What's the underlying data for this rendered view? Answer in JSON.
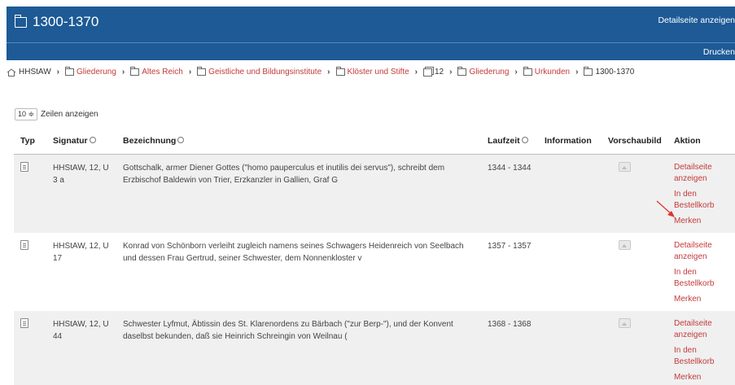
{
  "header": {
    "title": "1300-1370",
    "detail_link": "Detailseite anzeigen",
    "print_link": "Drucken"
  },
  "breadcrumb": [
    {
      "label": "HHStAW",
      "icon": "home-icon",
      "link": false
    },
    {
      "label": "Gliederung",
      "icon": "folder-icon",
      "link": true
    },
    {
      "label": "Altes Reich",
      "icon": "folder-icon",
      "link": true
    },
    {
      "label": "Geistliche und Bildungsinstitute",
      "icon": "folder-icon",
      "link": true
    },
    {
      "label": "Klöster und Stifte",
      "icon": "folder-icon",
      "link": true
    },
    {
      "label": "12",
      "icon": "stack-icon",
      "link": false
    },
    {
      "label": "Gliederung",
      "icon": "folder-icon",
      "link": true
    },
    {
      "label": "Urkunden",
      "icon": "folder-icon",
      "link": true
    },
    {
      "label": "1300-1370",
      "icon": "folder-icon",
      "link": false
    }
  ],
  "length": {
    "value": "10 ≑",
    "label": "Zeilen anzeigen"
  },
  "table": {
    "columns": {
      "typ": "Typ",
      "signatur": "Signatur",
      "bezeichnung": "Bezeichnung",
      "laufzeit": "Laufzeit",
      "information": "Information",
      "vorschaubild": "Vorschaubild",
      "aktion": "Aktion"
    },
    "actions": {
      "detail": "Detailseite anzeigen",
      "basket": "In den Bestellkorb",
      "remember": "Merken"
    },
    "rows": [
      {
        "signatur": "HHStAW, 12, U 3 a",
        "bezeichnung": "Gottschalk, armer Diener Gottes (\"homo pauperculus et inutilis dei servus\"), schreibt dem Erzbischof Baldewin von Trier, Erzkanzler in Gallien, Graf G",
        "laufzeit": "1344 - 1344",
        "information": ""
      },
      {
        "signatur": "HHStAW, 12, U 17",
        "bezeichnung": "Konrad von Schönborn verleiht zugleich namens seines Schwagers Heidenreich von Seelbach und dessen Frau Gertrud, seiner Schwester, dem Nonnenkloster v",
        "laufzeit": "1357 - 1357",
        "information": ""
      },
      {
        "signatur": "HHStAW, 12, U 44",
        "bezeichnung": "Schwester Lyfmut, Äbtissin des St. Klarenordens zu Bärbach (\"zur Berp-\"), und der Konvent daselbst bekunden, daß sie Heinrich Schreingin von Weilnau (",
        "laufzeit": "1368 - 1368",
        "information": ""
      }
    ]
  },
  "colors": {
    "header_bg": "#1d5a96",
    "link": "#c43a3a",
    "row_alt": "#f0f0f0",
    "annotation": "#e0342c"
  }
}
